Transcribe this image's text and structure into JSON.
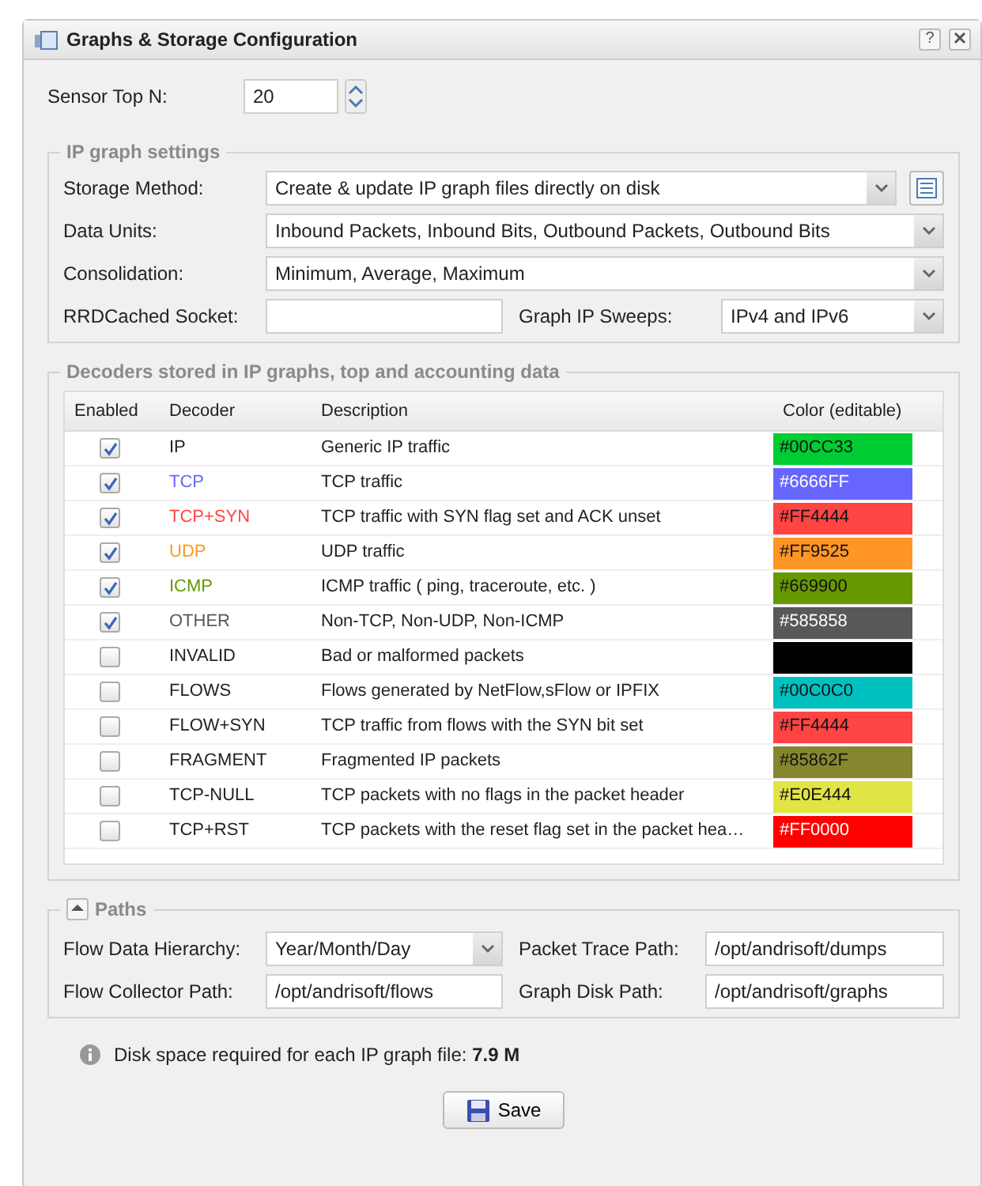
{
  "window": {
    "title": "Graphs & Storage Configuration",
    "help": "?"
  },
  "sensor_top_n": {
    "label": "Sensor Top N:",
    "value": "20"
  },
  "ip_graph_settings": {
    "title": "IP graph settings",
    "storage_method": {
      "label": "Storage Method:",
      "value": "Create & update IP graph files directly on disk"
    },
    "data_units": {
      "label": "Data Units:",
      "value": "Inbound Packets, Inbound Bits, Outbound Packets, Outbound Bits"
    },
    "consolidation": {
      "label": "Consolidation:",
      "value": "Minimum, Average, Maximum"
    },
    "rrdcached_socket": {
      "label": "RRDCached Socket:"
    },
    "graph_ip_sweeps": {
      "label": "Graph IP Sweeps:",
      "value": "IPv4 and IPv6"
    }
  },
  "decoders": {
    "title": "Decoders stored in IP graphs, top and accounting data",
    "columns": [
      "Enabled",
      "Decoder",
      "Description",
      "Color (editable)"
    ],
    "rows": [
      {
        "enabled": true,
        "decoder": "IP",
        "name_colored": false,
        "description": "Generic IP traffic",
        "color": "#00cc33",
        "color_text": "#00CC33"
      },
      {
        "enabled": true,
        "decoder": "TCP",
        "name_colored": true,
        "description": "TCP traffic",
        "color": "#6666ff",
        "color_text": "#6666FF"
      },
      {
        "enabled": true,
        "decoder": "TCP+SYN",
        "name_colored": true,
        "description": "TCP traffic with SYN flag set and ACK unset",
        "color": "#ff4444",
        "color_text": "#FF4444"
      },
      {
        "enabled": true,
        "decoder": "UDP",
        "name_colored": true,
        "description": "UDP traffic",
        "color": "#ff9525",
        "color_text": "#FF9525"
      },
      {
        "enabled": true,
        "decoder": "ICMP",
        "name_colored": true,
        "description": "ICMP traffic ( ping, traceroute, etc. )",
        "color": "#669900",
        "color_text": "#669900"
      },
      {
        "enabled": true,
        "decoder": "OTHER",
        "name_colored": true,
        "description": "Non-TCP, Non-UDP, Non-ICMP",
        "color": "#585858",
        "color_text": "#585858"
      },
      {
        "enabled": false,
        "decoder": "INVALID",
        "name_colored": false,
        "description": "Bad or malformed packets",
        "color": "#000000"
      },
      {
        "enabled": false,
        "decoder": "FLOWS",
        "name_colored": false,
        "description": "Flows generated by NetFlow,sFlow or IPFIX",
        "color": "#00c0c0",
        "color_text": "#00C0C0"
      },
      {
        "enabled": false,
        "decoder": "FLOW+SYN",
        "name_colored": false,
        "description": "TCP traffic from flows with the SYN bit set",
        "color": "#ff4444",
        "color_text": "#FF4444"
      },
      {
        "enabled": false,
        "decoder": "FRAGMENT",
        "name_colored": false,
        "description": "Fragmented IP packets",
        "color": "#85862f",
        "color_text": "#85862F"
      },
      {
        "enabled": false,
        "decoder": "TCP-NULL",
        "name_colored": false,
        "description": "TCP packets with no flags in the packet header",
        "color": "#e0e444",
        "color_text": "#E0E444"
      },
      {
        "enabled": false,
        "decoder": "TCP+RST",
        "name_colored": false,
        "description": "TCP packets with the reset flag set in the packet hea…",
        "color": "#ff0000",
        "color_text": "#FF0000"
      }
    ]
  },
  "paths": {
    "title": "Paths",
    "expanded": true,
    "flow_data_hierarchy": {
      "label": "Flow Data Hierarchy:",
      "value": "Year/Month/Day"
    },
    "packet_trace_path": {
      "label": "Packet Trace Path:",
      "value": "/opt/andrisoft/dumps"
    },
    "flow_collector_path": {
      "label": "Flow Collector Path:",
      "value": "/opt/andrisoft/flows"
    },
    "graph_disk_path": {
      "label": "Graph Disk Path:",
      "value": "/opt/andrisoft/graphs"
    }
  },
  "info": "Disk space required for each IP graph file: **7.9 M**",
  "save_button": "Save"
}
